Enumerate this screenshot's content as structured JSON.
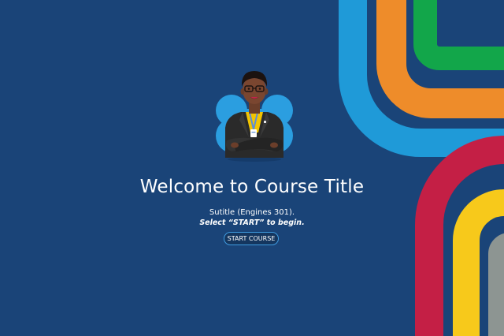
{
  "welcome": {
    "title": "Welcome to Course Title",
    "subtitle": "Sutitle (Engines 301).",
    "instruction": "Select “START” to begin.",
    "start_button_label": "START COURSE"
  },
  "colors": {
    "background": "#1a4478",
    "stripe_light_blue": "#1f9ad8",
    "stripe_orange": "#ee8c2a",
    "stripe_green": "#12a64a",
    "stripe_red": "#c41f45",
    "stripe_yellow": "#f7c91b",
    "stripe_gray": "#8d9592",
    "button_border": "#3f9be0"
  },
  "avatar": {
    "icon": "instructor-avatar-icon"
  }
}
